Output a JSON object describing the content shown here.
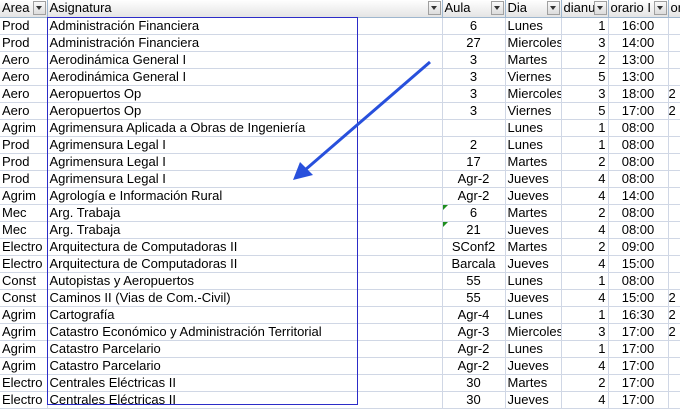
{
  "headers": [
    {
      "label": "Area",
      "filter": true
    },
    {
      "label": "Asignatura",
      "filter": true
    },
    {
      "label": "Aula",
      "filter": true
    },
    {
      "label": "Dia",
      "filter": true
    },
    {
      "label": "dianu",
      "filter": true
    },
    {
      "label": "orario I",
      "filter": true
    },
    {
      "label": "ora",
      "filter": false
    }
  ],
  "rows": [
    [
      "Prod",
      "Administración Financiera",
      "6",
      "Lunes",
      "1",
      "16:00",
      ""
    ],
    [
      "Prod",
      "Administración Financiera",
      "27",
      "Miercoles",
      "3",
      "14:00",
      ""
    ],
    [
      "Aero",
      "Aerodinámica General I",
      "3",
      "Martes",
      "2",
      "13:00",
      ""
    ],
    [
      "Aero",
      "Aerodinámica General I",
      "3",
      "Viernes",
      "5",
      "13:00",
      ""
    ],
    [
      "Aero",
      "Aeropuertos Op",
      "3",
      "Miercoles",
      "3",
      "18:00",
      "2"
    ],
    [
      "Aero",
      "Aeropuertos Op",
      "3",
      "Viernes",
      "5",
      "17:00",
      "2"
    ],
    [
      "Agrim",
      "Agrimensura Aplicada a Obras de Ingeniería",
      "",
      "Lunes",
      "1",
      "08:00",
      ""
    ],
    [
      "Prod",
      "Agrimensura Legal I",
      "2",
      "Lunes",
      "1",
      "08:00",
      ""
    ],
    [
      "Prod",
      "Agrimensura Legal I",
      "17",
      "Martes",
      "2",
      "08:00",
      ""
    ],
    [
      "Prod",
      "Agrimensura Legal I",
      "Agr-2",
      "Jueves",
      "4",
      "08:00",
      ""
    ],
    [
      "Agrim",
      "Agrología e Información Rural",
      "Agr-2",
      "Jueves",
      "4",
      "14:00",
      ""
    ],
    [
      "Mec",
      "Arg. Trabaja",
      "6",
      "Martes",
      "2",
      "08:00",
      ""
    ],
    [
      "Mec",
      "Arg. Trabaja",
      "21",
      "Jueves",
      "4",
      "08:00",
      ""
    ],
    [
      "Electro",
      "Arquitectura de Computadoras II",
      "SConf2",
      "Martes",
      "2",
      "09:00",
      ""
    ],
    [
      "Electro",
      "Arquitectura de Computadoras II",
      "Barcala",
      "Jueves",
      "4",
      "15:00",
      ""
    ],
    [
      "Const",
      "Autopistas y Aeropuertos",
      "55",
      "Lunes",
      "1",
      "08:00",
      ""
    ],
    [
      "Const",
      "Caminos II (Vias de Com.-Civil)",
      "55",
      "Jueves",
      "4",
      "15:00",
      "2"
    ],
    [
      "Agrim",
      "Cartografía",
      "Agr-4",
      "Lunes",
      "1",
      "16:30",
      "2"
    ],
    [
      "Agrim",
      "Catastro Económico y Administración Territorial",
      "Agr-3",
      "Miercoles",
      "3",
      "17:00",
      "2"
    ],
    [
      "Agrim",
      "Catastro Parcelario",
      "Agr-2",
      "Lunes",
      "1",
      "17:00",
      ""
    ],
    [
      "Agrim",
      "Catastro Parcelario",
      "Agr-2",
      "Jueves",
      "4",
      "17:00",
      ""
    ],
    [
      "Electro",
      "Centrales Eléctricas II",
      "30",
      "Martes",
      "2",
      "17:00",
      ""
    ],
    [
      "Electro",
      "Centrales Eléctricas II",
      "30",
      "Jueves",
      "4",
      "17:00",
      ""
    ]
  ],
  "comment_indicators": [
    {
      "row": 11
    },
    {
      "row": 12
    }
  ],
  "annotation": {
    "box_color": "#2c2cc8",
    "arrow_color": "#2850dc"
  }
}
